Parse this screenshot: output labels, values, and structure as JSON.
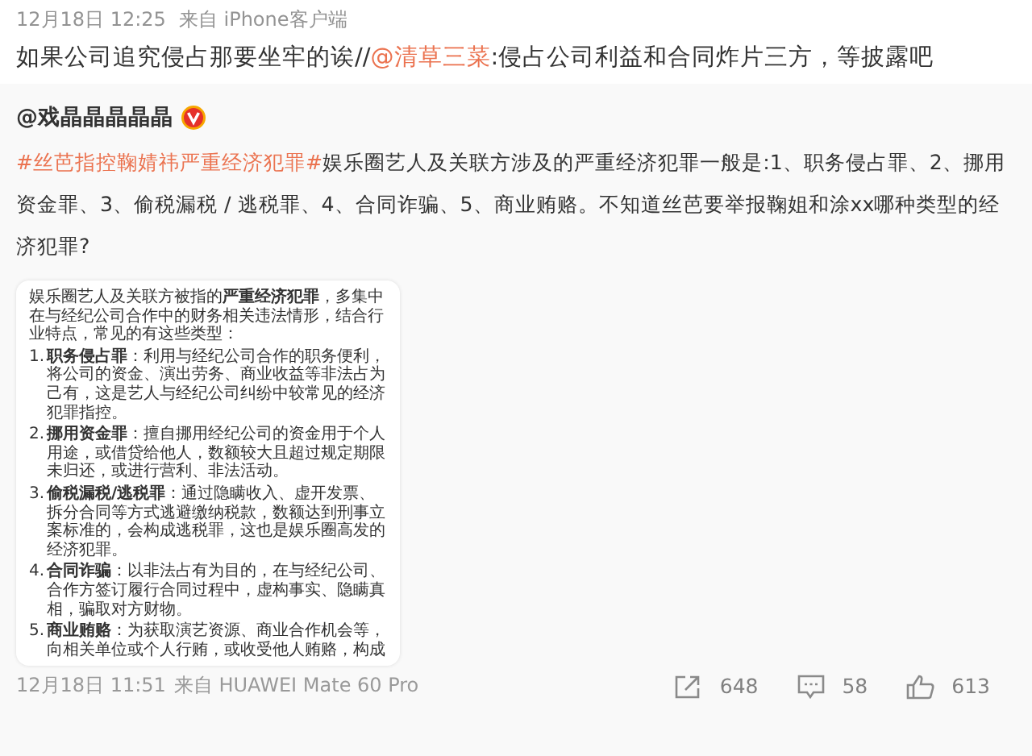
{
  "comment": {
    "time": "12月18日 12:25",
    "source": "来自 iPhone客户端",
    "text_before": "如果公司追究侵占那要坐牢的诶//",
    "mention": "@清草三菜",
    "text_after": ":侵占公司利益和合同炸片三方，等披露吧"
  },
  "repost": {
    "author": "@戏晶晶晶晶晶",
    "verified": true,
    "topic": "#丝芭指控鞠婧祎严重经济犯罪#",
    "text": "娱乐圈艺人及关联方涉及的严重经济犯罪一般是:1、职务侵占罪、2、挪用资金罪、3、偷税漏税 / 逃税罪、4、合同诈骗、5、商业贿赂。不知道丝芭要举报鞠姐和涂xx哪种类型的经济犯罪?",
    "image": {
      "intro": "娱乐圈艺人及关联方被指的**严重经济犯罪**，多集中在与经纪公司合作中的财务相关违法情形，结合行业特点，常见的有这些类型：",
      "items": [
        {
          "number": "1.",
          "text": "**职务侵占罪**：利用与经纪公司合作的职务便利，将公司的资金、演出劳务、商业收益等非法占为己有，这是艺人与经纪公司纠纷中较常见的经济犯罪指控。"
        },
        {
          "number": "2.",
          "text": "**挪用资金罪**：擅自挪用经纪公司的资金用于个人用途，或借贷给他人，数额较大且超过规定期限未归还，或进行营利、非法活动。"
        },
        {
          "number": "3.",
          "text": "**偷税漏税/逃税罪**：通过隐瞒收入、虚开发票、拆分合同等方式逃避缴纳税款，数额达到刑事立案标准的，会构成逃税罪，这也是娱乐圈高发的经济犯罪。"
        },
        {
          "number": "4.",
          "text": "**合同诈骗**：以非法占有为目的，在与经纪公司、合作方签订履行合同过程中，虚构事实、隐瞒真相，骗取对方财物。"
        },
        {
          "number": "5.",
          "text": "**商业贿赂**：为获取演艺资源、商业合作机会等，向相关单位或个人行贿，或收受他人贿赂，构成"
        }
      ]
    },
    "time": "12月18日 11:51",
    "source": "来自 HUAWEI Mate 60 Pro",
    "actions": [
      {
        "kind": "share",
        "count": "648"
      },
      {
        "kind": "comment",
        "count": "58"
      },
      {
        "kind": "like",
        "count": "613"
      }
    ]
  }
}
